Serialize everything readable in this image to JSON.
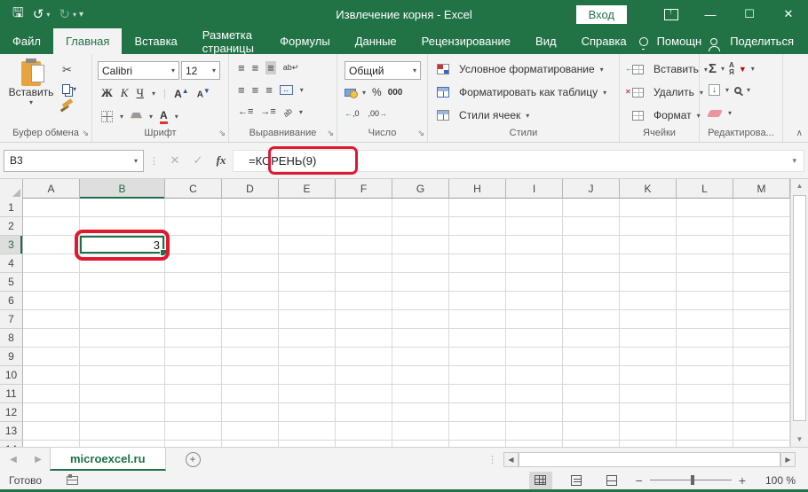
{
  "window": {
    "title": "Извлечение корня  -  Excel",
    "sign_in_label": "Вход"
  },
  "tabs": [
    {
      "label": "Файл"
    },
    {
      "label": "Главная"
    },
    {
      "label": "Вставка"
    },
    {
      "label": "Разметка страницы"
    },
    {
      "label": "Формулы"
    },
    {
      "label": "Данные"
    },
    {
      "label": "Рецензирование"
    },
    {
      "label": "Вид"
    },
    {
      "label": "Справка"
    },
    {
      "label": "Помощн"
    },
    {
      "label": "Поделиться"
    }
  ],
  "ribbon": {
    "clipboard": {
      "label": "Буфер обмена",
      "paste": "Вставить"
    },
    "font": {
      "label": "Шрифт",
      "font_name": "Calibri",
      "font_size": "12",
      "bold": "Ж",
      "italic": "К",
      "underline": "Ч",
      "grow": "А",
      "shrink": "А",
      "color_letter": "А"
    },
    "alignment": {
      "label": "Выравнивание",
      "wrap": "ab",
      "orientation": "ab"
    },
    "number": {
      "label": "Число",
      "format": "Общий",
      "percent": "%",
      "thousands": "000",
      "inc_decimal": ",0",
      "dec_decimal": ",00"
    },
    "styles": {
      "label": "Стили",
      "conditional": "Условное форматирование",
      "format_table": "Форматировать как таблицу",
      "cell_styles": "Стили ячеек"
    },
    "cells": {
      "label": "Ячейки",
      "insert": "Вставить",
      "delete": "Удалить",
      "format": "Формат"
    },
    "editing": {
      "label": "Редактирова...",
      "sum": "Σ",
      "sort_top": "А",
      "sort_bottom": "Я",
      "fill_arrow": "↓"
    }
  },
  "formula_bar": {
    "name_box": "B3",
    "fx": "fx",
    "formula": "=КОРЕНЬ(9)"
  },
  "grid": {
    "columns": [
      "A",
      "B",
      "C",
      "D",
      "E",
      "F",
      "G",
      "H",
      "I",
      "J",
      "K",
      "L",
      "M"
    ],
    "row_count": 13,
    "selected_cell": {
      "column": "B",
      "row": 3,
      "value": "3"
    }
  },
  "sheet_bar": {
    "tab_name": "microexcel.ru"
  },
  "status_bar": {
    "mode": "Готово",
    "zoom": "100 %"
  },
  "colors": {
    "excel_green": "#217346",
    "annotation_red": "#e01931",
    "selection_green": "#1e7145"
  }
}
